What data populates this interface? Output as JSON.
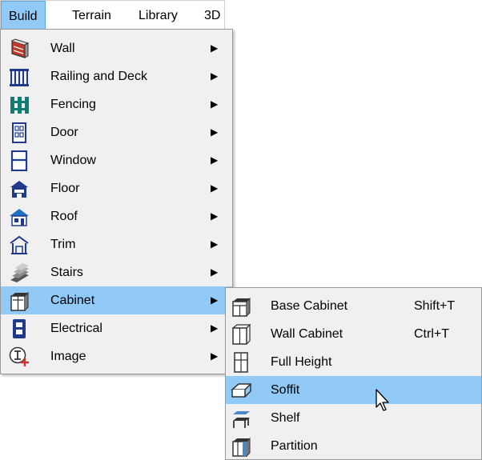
{
  "menubar": {
    "items": [
      {
        "label": "Build"
      },
      {
        "label": "Terrain"
      },
      {
        "label": "Library"
      },
      {
        "label": "3D"
      }
    ]
  },
  "build_menu": {
    "arrow_glyph": "▶",
    "items": [
      {
        "label": "Wall",
        "icon": "wall-icon"
      },
      {
        "label": "Railing and Deck",
        "icon": "railing-icon"
      },
      {
        "label": "Fencing",
        "icon": "fencing-icon"
      },
      {
        "label": "Door",
        "icon": "door-icon"
      },
      {
        "label": "Window",
        "icon": "window-icon"
      },
      {
        "label": "Floor",
        "icon": "floor-icon"
      },
      {
        "label": "Roof",
        "icon": "roof-icon"
      },
      {
        "label": "Trim",
        "icon": "trim-icon"
      },
      {
        "label": "Stairs",
        "icon": "stairs-icon"
      },
      {
        "label": "Cabinet",
        "icon": "cabinet-icon",
        "highlighted": true
      },
      {
        "label": "Electrical",
        "icon": "electrical-icon"
      },
      {
        "label": "Image",
        "icon": "image-icon"
      }
    ]
  },
  "cabinet_submenu": {
    "items": [
      {
        "label": "Base Cabinet",
        "shortcut": "Shift+T",
        "icon": "base-cabinet-icon"
      },
      {
        "label": "Wall Cabinet",
        "shortcut": "Ctrl+T",
        "icon": "wall-cabinet-icon"
      },
      {
        "label": "Full Height",
        "shortcut": "",
        "icon": "full-height-icon"
      },
      {
        "label": "Soffit",
        "shortcut": "",
        "icon": "soffit-icon",
        "highlighted": true
      },
      {
        "label": "Shelf",
        "shortcut": "",
        "icon": "shelf-icon"
      },
      {
        "label": "Partition",
        "shortcut": "",
        "icon": "partition-icon"
      }
    ]
  },
  "colors": {
    "highlight": "#91c9f7",
    "menu_bg": "#f0f0f0",
    "icon_blue": "#1f3a8a",
    "icon_red": "#c0392b"
  }
}
